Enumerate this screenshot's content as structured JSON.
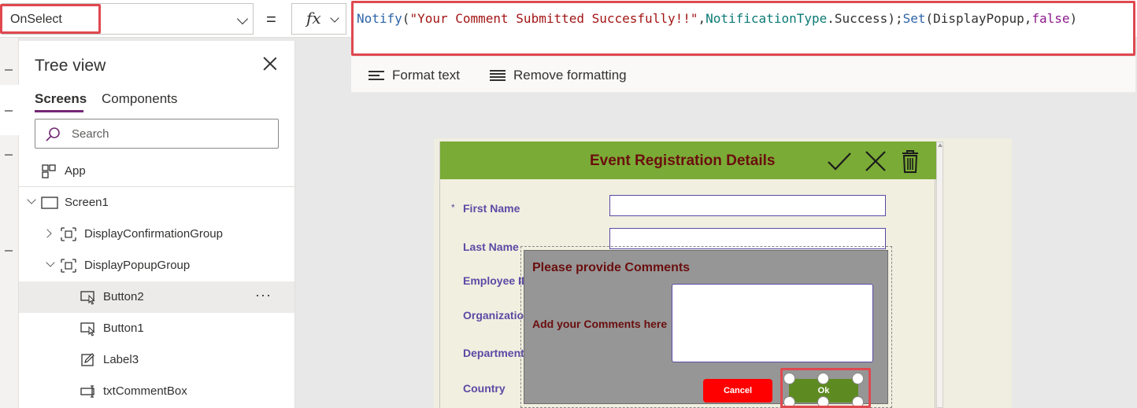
{
  "formula_bar": {
    "property": "OnSelect",
    "equals": "=",
    "fx": "fx",
    "formula_tokens": [
      {
        "text": "Notify",
        "kind": "fn"
      },
      {
        "text": "(",
        "kind": "txt"
      },
      {
        "text": "\"Your Comment Submitted Succesfully!!\"",
        "kind": "str"
      },
      {
        "text": ",",
        "kind": "txt"
      },
      {
        "text": "NotificationType",
        "kind": "enum"
      },
      {
        "text": ".Success);",
        "kind": "txt"
      },
      {
        "text": "Set",
        "kind": "fn"
      },
      {
        "text": "(DisplayPopup,",
        "kind": "txt"
      },
      {
        "text": "false",
        "kind": "kw"
      },
      {
        "text": ")",
        "kind": "txt"
      }
    ],
    "format_text": "Format text",
    "remove_formatting": "Remove formatting"
  },
  "tree_view": {
    "title": "Tree view",
    "tabs": [
      "Screens",
      "Components"
    ],
    "search_placeholder": "Search",
    "app_label": "App",
    "nodes": [
      {
        "label": "Screen1"
      },
      {
        "label": "DisplayConfirmationGroup"
      },
      {
        "label": "DisplayPopupGroup"
      },
      {
        "label": "Button2",
        "more": "···"
      },
      {
        "label": "Button1"
      },
      {
        "label": "Label3"
      },
      {
        "label": "txtCommentBox"
      }
    ]
  },
  "form": {
    "title": "Event Registration Details",
    "required_mark": "*",
    "fields": [
      "First Name",
      "Last Name",
      "Employee ID",
      "Organization",
      "Department",
      "Country"
    ]
  },
  "popup": {
    "title": "Please provide Comments",
    "comment_label": "Add your Comments here",
    "cancel_label": "Cancel",
    "ok_label": "Ok"
  },
  "colors": {
    "highlight": "#e0484f",
    "header_green": "#7aab36",
    "title_maroon": "#6b0e0e",
    "label_purple": "#5a4aa6",
    "cancel_red": "#ff0000",
    "ok_green": "#5d8b22"
  }
}
